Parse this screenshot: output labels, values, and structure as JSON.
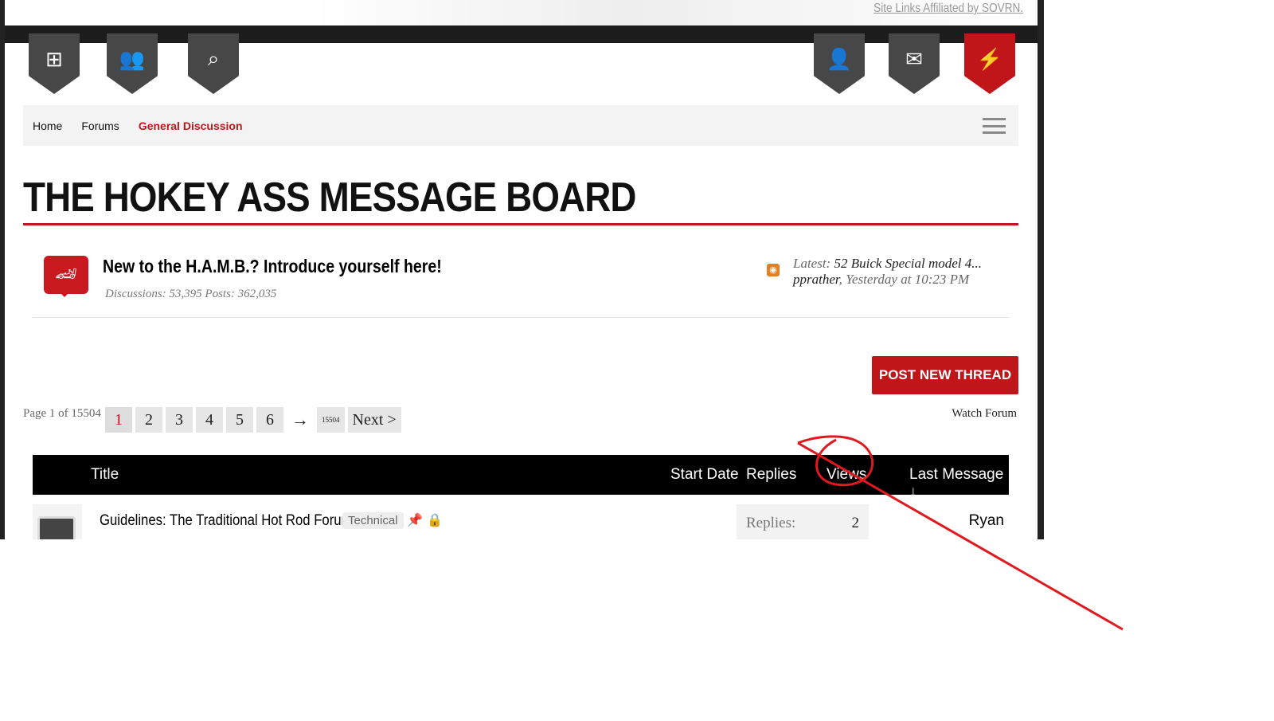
{
  "header": {
    "affiliate_link": "Site Links Affiliated by SOVRN.",
    "nav_icons_left": [
      "sitemap-icon",
      "members-icon",
      "search-icon"
    ],
    "nav_icons_right": [
      "user-icon",
      "mail-icon",
      "alerts-icon"
    ]
  },
  "breadcrumb": {
    "items": [
      "Home",
      "Forums"
    ],
    "current": "General Discussion"
  },
  "page_title": "THE HOKEY ASS MESSAGE BOARD",
  "forum": {
    "title": "New to the H.A.M.B.? Introduce yourself here!",
    "stats": "Discussions: 53,395 Posts: 362,035",
    "latest_label": "Latest:",
    "latest_thread": "52 Buick Special model 4...",
    "latest_user": "pprather",
    "latest_time": ", Yesterday at 10:23 PM"
  },
  "post_button": "POST NEW THREAD",
  "pagination": {
    "page_of": "Page 1 of 15504",
    "pages": [
      "1",
      "2",
      "3",
      "4",
      "5",
      "6"
    ],
    "arrow": "→",
    "last": "15504",
    "next": "Next >"
  },
  "watch_forum": "Watch Forum",
  "table": {
    "headers": {
      "title": "Title",
      "start_date": "Start Date",
      "replies": "Replies",
      "views": "Views",
      "last_message": "Last Message ↓"
    },
    "rows": [
      {
        "title": "Guidelines: The Traditional Hot Rod Forum",
        "tag": "Technical",
        "replies_label": "Replies:",
        "replies": "2",
        "last_user": "Ryan"
      }
    ]
  },
  "annotation_color": "#e0191f"
}
